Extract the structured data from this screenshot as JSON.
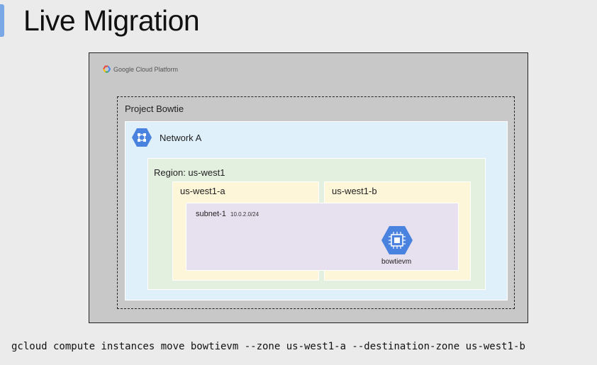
{
  "slide": {
    "title": "Live Migration"
  },
  "gcp": {
    "logo_text": "Google Cloud Platform"
  },
  "project": {
    "label": "Project Bowtie"
  },
  "network": {
    "label": "Network A",
    "icon": "network-hexagon-icon"
  },
  "region": {
    "label": "Region: us-west1"
  },
  "zones": [
    {
      "label": "us-west1-a"
    },
    {
      "label": "us-west1-b"
    }
  ],
  "subnet": {
    "label": "subnet-1",
    "cidr": "10.0.2.0/24"
  },
  "vm": {
    "label": "bowtievm",
    "icon": "compute-engine-chip-icon"
  },
  "command": {
    "text": "gcloud compute instances move bowtievm --zone us-west1-a --destination-zone us-west1-b"
  },
  "colors": {
    "accent_bar": "#7aa7e6",
    "frame": "#c8c8c8",
    "network": "#dff0fb",
    "region": "#e3efdf",
    "zone": "#fdf6d8",
    "subnet": "#e6e0ef",
    "hex_icon": "#4a82e0"
  }
}
